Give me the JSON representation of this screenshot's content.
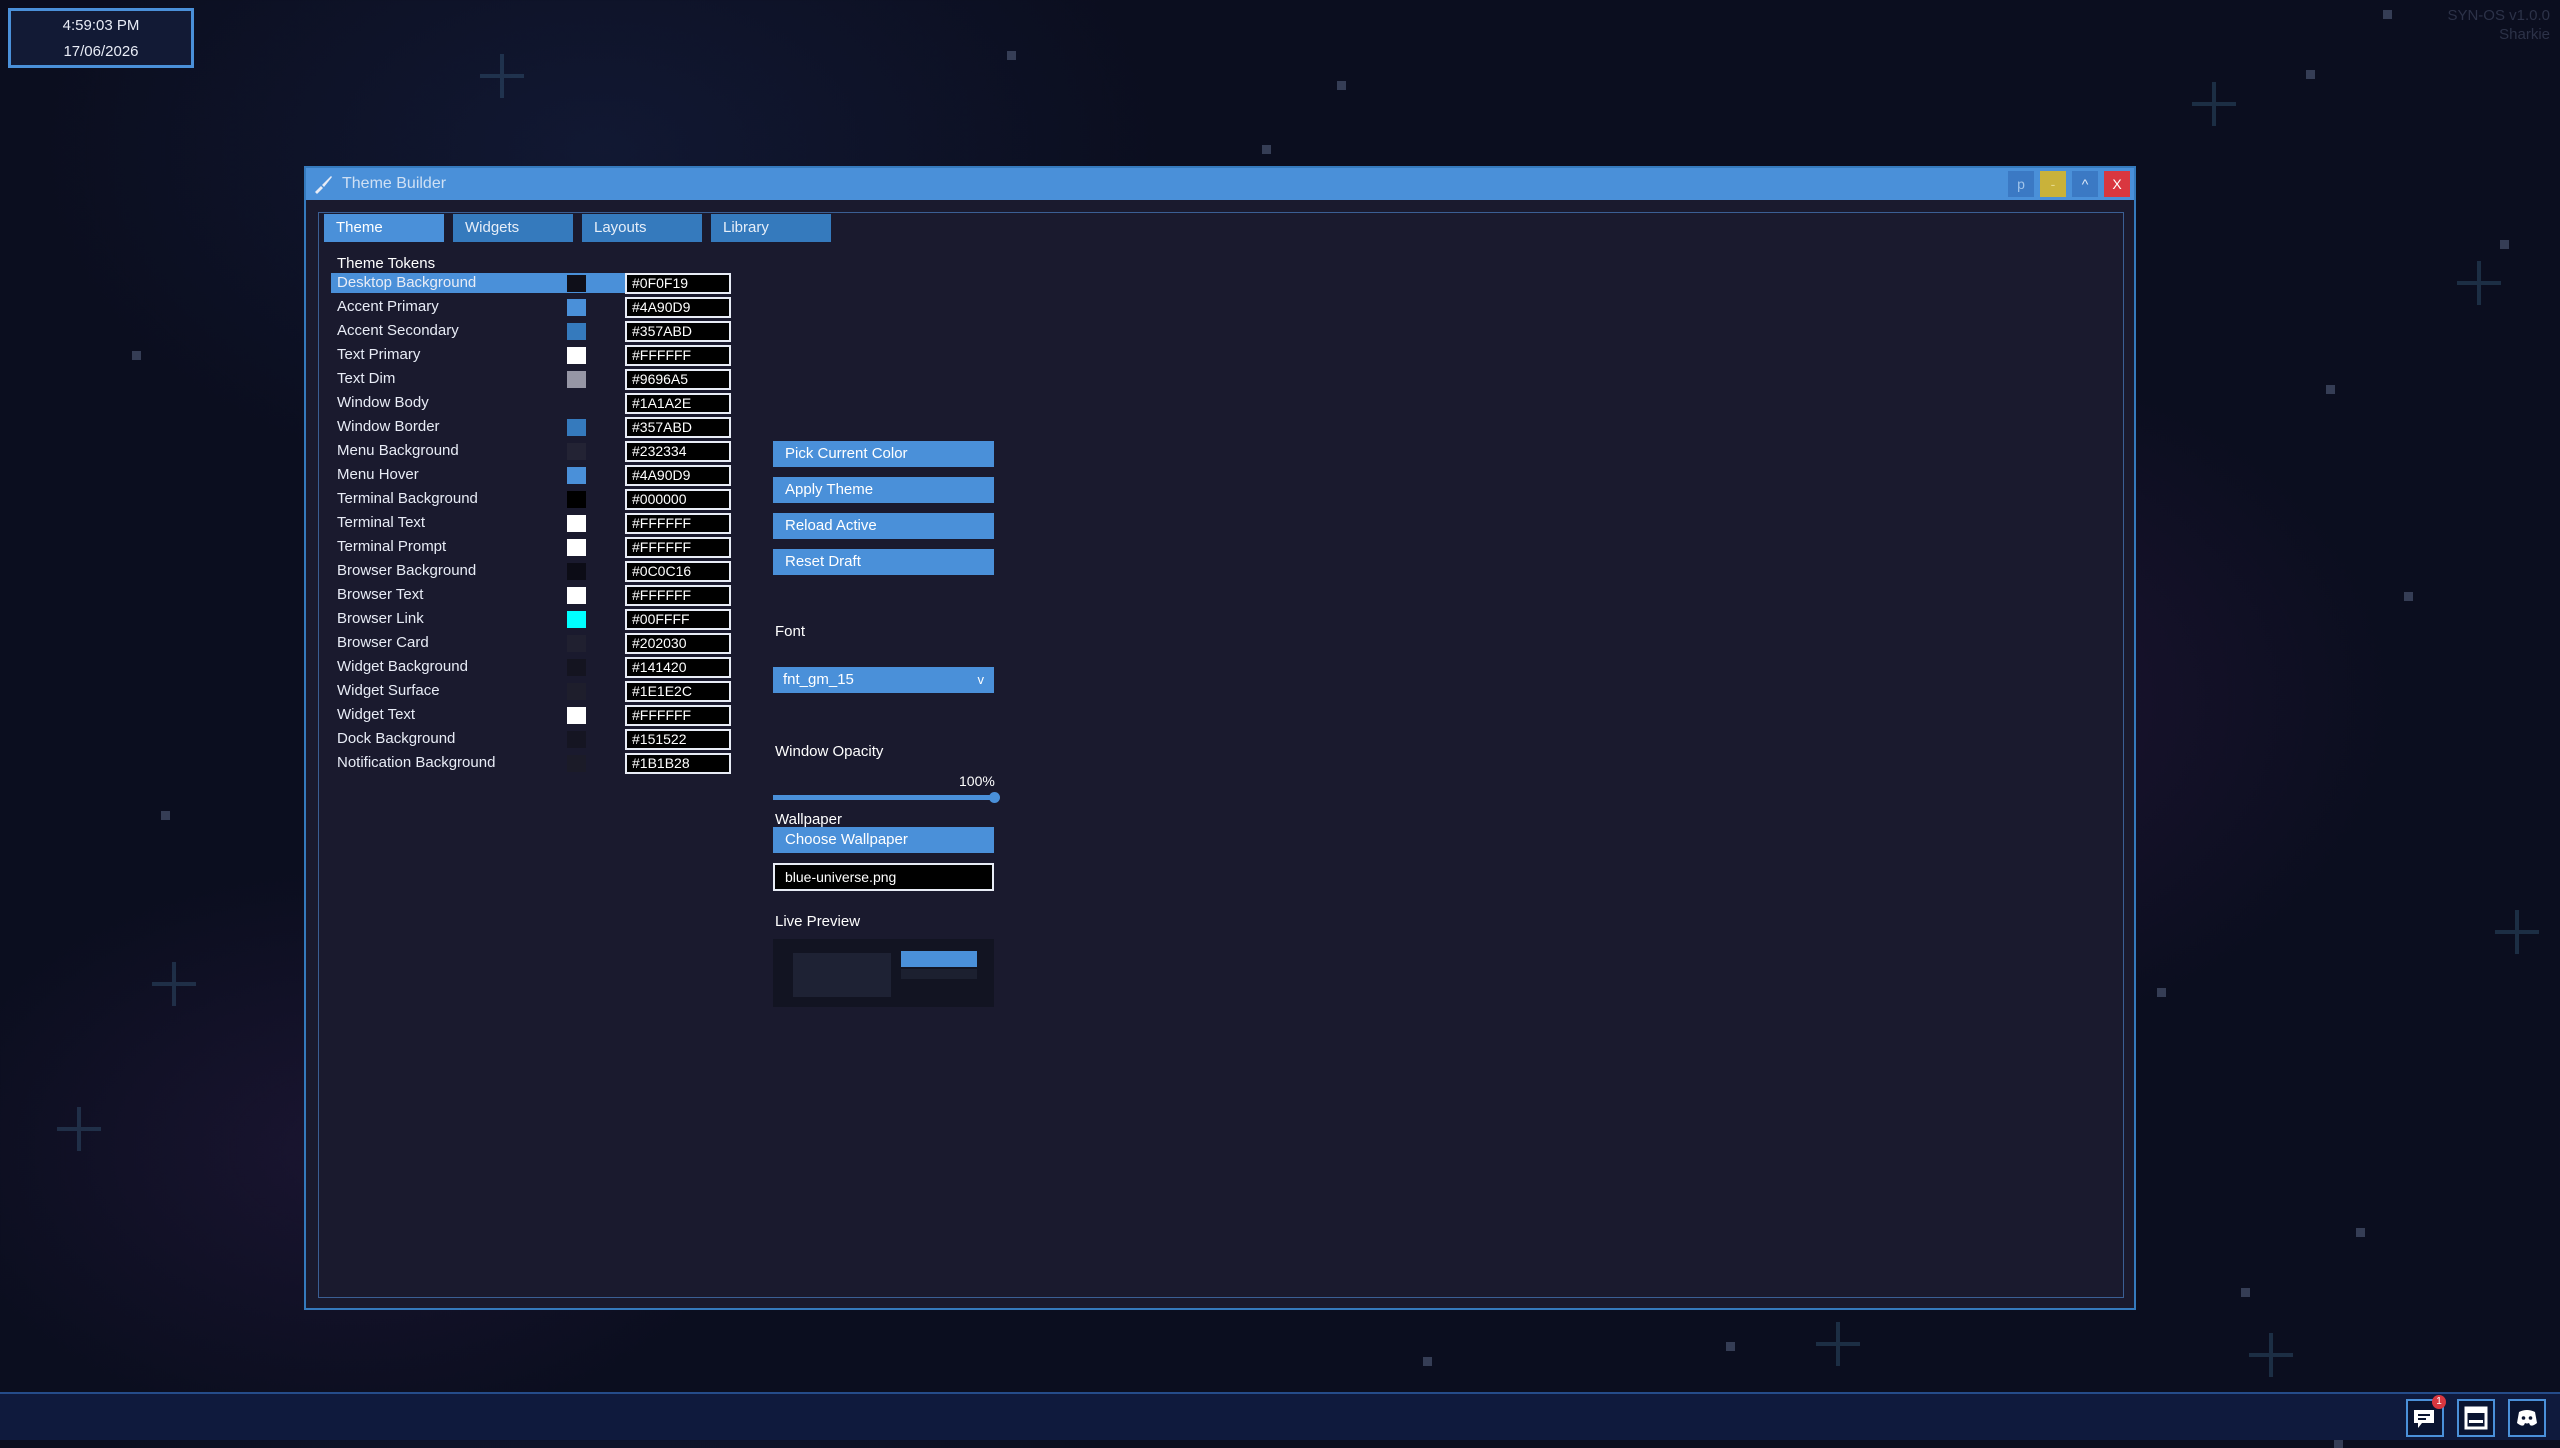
{
  "desktop": {
    "clock": {
      "time": "4:59:03 PM",
      "date": "17/06/2026"
    },
    "os_version": "SYN-OS v1.0.0",
    "os_user": "Sharkie"
  },
  "window": {
    "title": "Theme Builder",
    "title_icon": "brush-icon",
    "controls": {
      "pin": "p",
      "minimize": "-",
      "maximize": "^",
      "close": "X"
    },
    "tabs": [
      {
        "label": "Theme",
        "active": true
      },
      {
        "label": "Widgets",
        "active": false
      },
      {
        "label": "Layouts",
        "active": false
      },
      {
        "label": "Library",
        "active": false
      }
    ]
  },
  "theme_tokens": {
    "heading": "Theme Tokens",
    "selected": "Desktop Background",
    "items": [
      {
        "name": "Desktop Background",
        "value": "#0F0F19"
      },
      {
        "name": "Accent Primary",
        "value": "#4A90D9"
      },
      {
        "name": "Accent Secondary",
        "value": "#357ABD"
      },
      {
        "name": "Text Primary",
        "value": "#FFFFFF"
      },
      {
        "name": "Text Dim",
        "value": "#9696A5"
      },
      {
        "name": "Window Body",
        "value": "#1A1A2E"
      },
      {
        "name": "Window Border",
        "value": "#357ABD"
      },
      {
        "name": "Menu Background",
        "value": "#232334"
      },
      {
        "name": "Menu Hover",
        "value": "#4A90D9"
      },
      {
        "name": "Terminal Background",
        "value": "#000000"
      },
      {
        "name": "Terminal Text",
        "value": "#FFFFFF"
      },
      {
        "name": "Terminal Prompt",
        "value": "#FFFFFF"
      },
      {
        "name": "Browser Background",
        "value": "#0C0C16"
      },
      {
        "name": "Browser Text",
        "value": "#FFFFFF"
      },
      {
        "name": "Browser Link",
        "value": "#00FFFF"
      },
      {
        "name": "Browser Card",
        "value": "#202030"
      },
      {
        "name": "Widget Background",
        "value": "#141420"
      },
      {
        "name": "Widget Surface",
        "value": "#1E1E2C"
      },
      {
        "name": "Widget Text",
        "value": "#FFFFFF"
      },
      {
        "name": "Dock Background",
        "value": "#151522"
      },
      {
        "name": "Notification Background",
        "value": "#1B1B28"
      }
    ]
  },
  "actions": {
    "pick_color": "Pick Current Color",
    "apply_theme": "Apply Theme",
    "reload_active": "Reload Active",
    "reset_draft": "Reset Draft"
  },
  "font": {
    "label": "Font",
    "selected": "fnt_gm_15",
    "chevron": "v"
  },
  "opacity": {
    "label": "Window Opacity",
    "value_text": "100%",
    "value": 1.0
  },
  "wallpaper": {
    "label": "Wallpaper",
    "button": "Choose Wallpaper",
    "file": "blue-universe.png"
  },
  "live_preview": {
    "label": "Live Preview"
  },
  "taskbar": {
    "icons": [
      "chat-icon",
      "window-icon",
      "discord-icon"
    ],
    "chat_badge": "1"
  }
}
